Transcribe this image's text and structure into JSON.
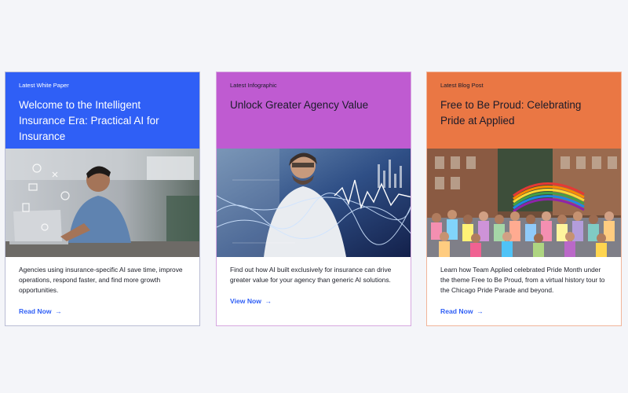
{
  "cards": [
    {
      "eyebrow": "Latest White Paper",
      "title": "Welcome to the Intelligent Insurance Era: Practical AI for Insurance",
      "image": "man-at-laptop-with-ai-icons",
      "description": "Agencies using insurance-specific AI save time, improve operations, respond faster, and find more growth opportunities.",
      "cta": "Read Now",
      "arrow": "→",
      "color": "#2f5ff6"
    },
    {
      "eyebrow": "Latest Infographic",
      "title": "Unlock Greater Agency Value",
      "image": "man-with-data-visualization",
      "description": "Find out how AI built exclusively for insurance can drive greater value for your agency than generic AI solutions.",
      "cta": "View Now",
      "arrow": "→",
      "color": "#bf5bd1"
    },
    {
      "eyebrow": "Latest Blog Post",
      "title": "Free to Be Proud: Celebrating Pride at Applied",
      "image": "pride-parade-group-photo",
      "description": "Learn how Team Applied celebrated Pride Month under the theme Free to Be Proud, from a virtual history tour to the Chicago Pride Parade and beyond.",
      "cta": "Read Now",
      "arrow": "→",
      "color": "#ea7744"
    }
  ]
}
